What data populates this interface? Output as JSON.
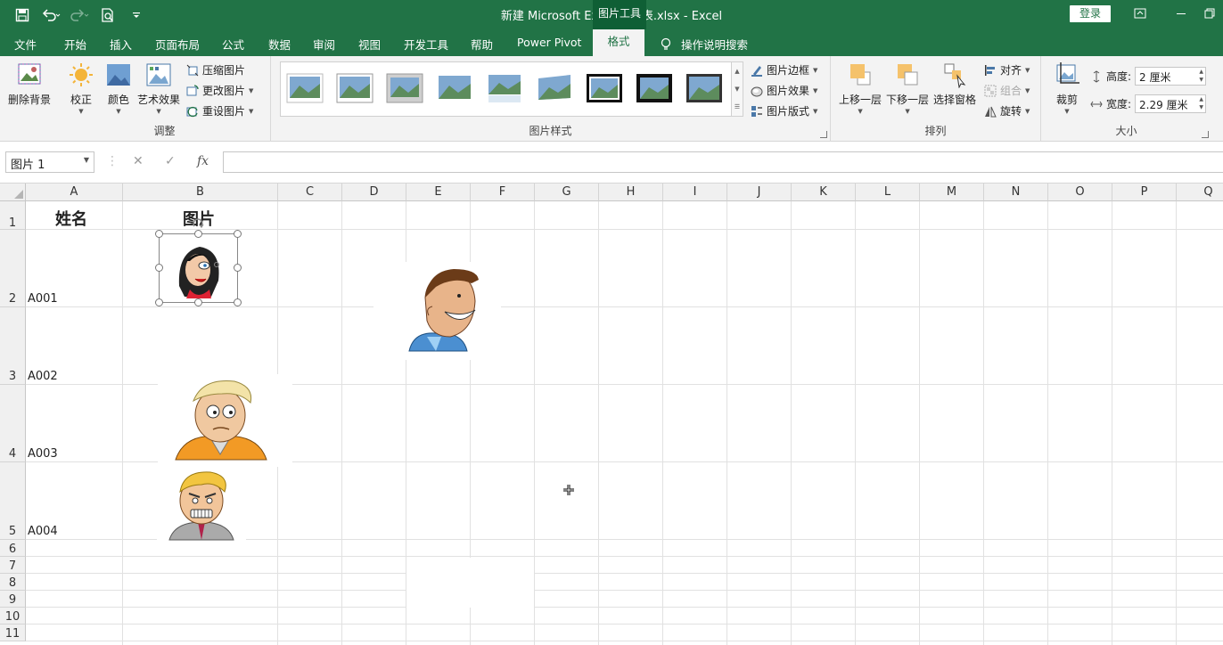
{
  "window": {
    "doc_title": "新建 Microsoft Excel 工作表.xlsx  -  Excel",
    "tools_title": "图片工具",
    "login": "登录"
  },
  "tabs": [
    "文件",
    "开始",
    "插入",
    "页面布局",
    "公式",
    "数据",
    "审阅",
    "视图",
    "开发工具",
    "帮助",
    "Power Pivot",
    "格式"
  ],
  "tell_me": "操作说明搜索",
  "ribbon": {
    "remove_bg": "删除背景",
    "adjust": {
      "corrections": "校正",
      "color": "颜色",
      "artistic": "艺术效果",
      "compress": "压缩图片",
      "change": "更改图片",
      "reset": "重设图片",
      "label": "调整"
    },
    "styles": {
      "border": "图片边框",
      "effects": "图片效果",
      "layout": "图片版式",
      "label": "图片样式"
    },
    "arrange": {
      "forward": "上移一层",
      "backward": "下移一层",
      "pane": "选择窗格",
      "align": "对齐",
      "group": "组合",
      "rotate": "旋转",
      "label": "排列"
    },
    "size": {
      "crop": "裁剪",
      "height_label": "高度:",
      "height_value": "2 厘米",
      "width_label": "宽度:",
      "width_value": "2.29 厘米",
      "label": "大小"
    }
  },
  "formula_bar": {
    "name_box": "图片 1",
    "cancel": "✕",
    "enter": "✓",
    "fx": "fx"
  },
  "columns": [
    "A",
    "B",
    "C",
    "D",
    "E",
    "F",
    "G",
    "H",
    "I",
    "J",
    "K",
    "L",
    "M",
    "N",
    "O",
    "P",
    "Q"
  ],
  "rows": [
    "1",
    "2",
    "3",
    "4",
    "5",
    "6",
    "7",
    "8",
    "9",
    "10",
    "11"
  ],
  "cells": {
    "A1": "姓名",
    "B1": "图片",
    "A2": "A001",
    "A3": "A002",
    "A4": "A003",
    "A5": "A004"
  },
  "colors": {
    "excel_green": "#217346",
    "ribbon_bg": "#f3f3f3"
  }
}
